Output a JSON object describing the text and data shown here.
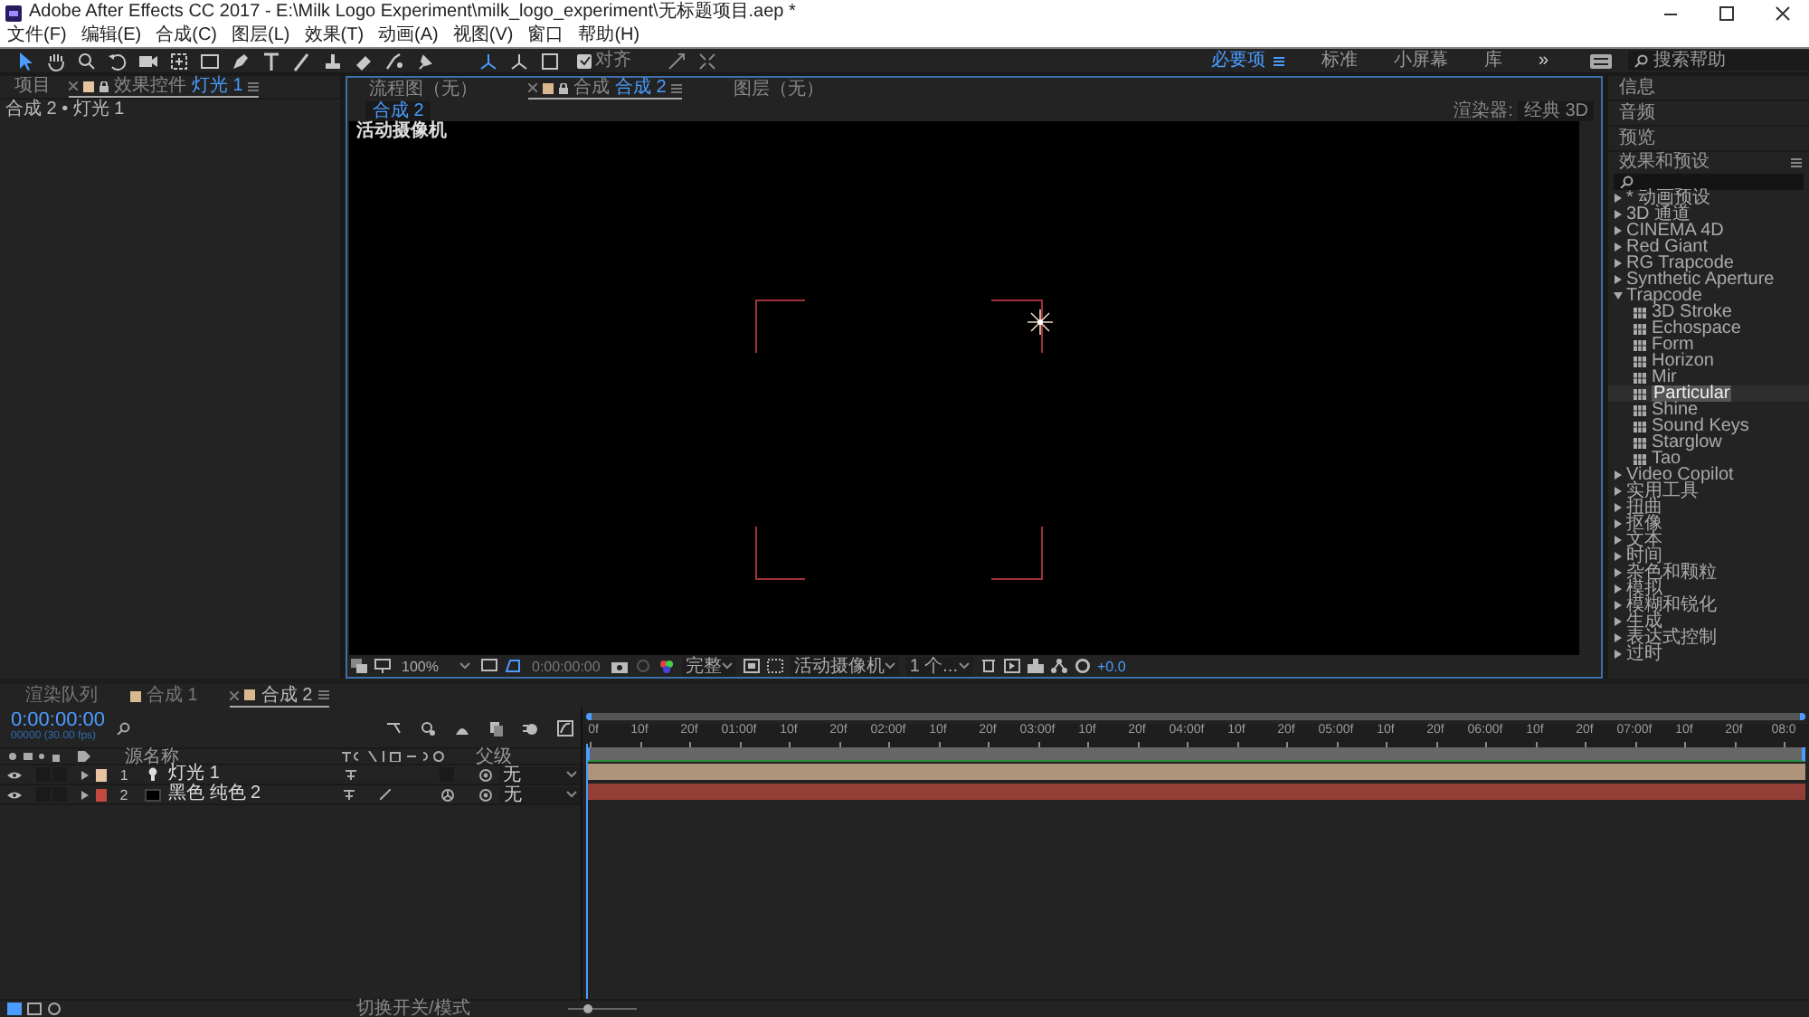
{
  "window": {
    "title": "Adobe After Effects CC 2017 - E:\\Milk Logo Experiment\\milk_logo_experiment\\无标题项目.aep *"
  },
  "menu": [
    "文件(F)",
    "编辑(E)",
    "合成(C)",
    "图层(L)",
    "效果(T)",
    "动画(A)",
    "视图(V)",
    "窗口",
    "帮助(H)"
  ],
  "tools": [
    {
      "kind": "arrow",
      "selected": true
    },
    {
      "kind": "hand",
      "selected": false
    },
    {
      "kind": "zoom",
      "selected": false
    },
    {
      "kind": "rotate",
      "selected": false
    },
    {
      "kind": "camera",
      "selected": false
    },
    {
      "kind": "pan",
      "selected": false
    },
    {
      "kind": "rect",
      "selected": false
    },
    {
      "kind": "pen",
      "selected": false
    },
    {
      "kind": "text",
      "selected": false
    },
    {
      "kind": "brush",
      "selected": false
    },
    {
      "kind": "stamp",
      "selected": false
    },
    {
      "kind": "eraser",
      "selected": false
    },
    {
      "kind": "roto",
      "selected": false
    },
    {
      "kind": "pin",
      "selected": false
    }
  ],
  "snapping": {
    "label": "对齐",
    "checked": true
  },
  "workspaces": [
    {
      "label": "必要项",
      "selected": true
    },
    {
      "label": "标准",
      "selected": false
    },
    {
      "label": "小屏幕",
      "selected": false
    },
    {
      "label": "库",
      "selected": false
    }
  ],
  "workspace_overflow": "»",
  "help_search": {
    "placeholder": "搜索帮助"
  },
  "left_panel": {
    "tabs": [
      {
        "label": "项目",
        "selected": false
      },
      {
        "label": "效果控件",
        "target": "灯光 1",
        "selected": true
      }
    ],
    "subtitle": "合成 2 • 灯光 1"
  },
  "comp_panel": {
    "tabs": [
      {
        "label": "流程图（无）",
        "selected": false
      },
      {
        "label": "合成",
        "target": "合成 2",
        "selected": true
      },
      {
        "label": "图层（无）",
        "selected": false
      }
    ],
    "subtab": "合成 2",
    "renderer_label": "渲染器:",
    "renderer": "经典 3D",
    "view_label": "活动摄像机",
    "footer": {
      "zoom": "100%",
      "time": "0:00:00:00",
      "resolution": "完整",
      "camera": "活动摄像机",
      "views": "1 个...",
      "exposure": "+0.0"
    }
  },
  "right_panel": {
    "sections": [
      "信息",
      "音频",
      "预览"
    ],
    "effects_title": "效果和预设",
    "effects": [
      {
        "label": "* 动画预设",
        "expanded": false
      },
      {
        "label": "3D 通道",
        "expanded": false
      },
      {
        "label": "CINEMA 4D",
        "expanded": false
      },
      {
        "label": "Red Giant",
        "expanded": false
      },
      {
        "label": "RG Trapcode",
        "expanded": false
      },
      {
        "label": "Synthetic Aperture",
        "expanded": false
      },
      {
        "label": "Trapcode",
        "expanded": true,
        "children": [
          {
            "label": "3D Stroke",
            "selected": false
          },
          {
            "label": "Echospace",
            "selected": false
          },
          {
            "label": "Form",
            "selected": false
          },
          {
            "label": "Horizon",
            "selected": false
          },
          {
            "label": "Mir",
            "selected": false
          },
          {
            "label": "Particular",
            "selected": true
          },
          {
            "label": "Shine",
            "selected": false
          },
          {
            "label": "Sound Keys",
            "selected": false
          },
          {
            "label": "Starglow",
            "selected": false
          },
          {
            "label": "Tao",
            "selected": false
          }
        ]
      },
      {
        "label": "Video Copilot",
        "expanded": false
      },
      {
        "label": "实用工具",
        "expanded": false
      },
      {
        "label": "扭曲",
        "expanded": false
      },
      {
        "label": "抠像",
        "expanded": false
      },
      {
        "label": "文本",
        "expanded": false
      },
      {
        "label": "时间",
        "expanded": false
      },
      {
        "label": "杂色和颗粒",
        "expanded": false
      },
      {
        "label": "模拟",
        "expanded": false
      },
      {
        "label": "模糊和锐化",
        "expanded": false
      },
      {
        "label": "生成",
        "expanded": false
      },
      {
        "label": "表达式控制",
        "expanded": false
      },
      {
        "label": "过时",
        "expanded": false
      }
    ]
  },
  "timeline": {
    "tabs": [
      {
        "label": "渲染队列",
        "selected": false
      },
      {
        "label": "合成 1",
        "selected": false
      },
      {
        "label": "合成 2",
        "selected": true
      }
    ],
    "time": "0:00:00:00",
    "frame_info": "00000 (30.00 fps)",
    "columns": [
      "源名称",
      "父级"
    ],
    "layers": [
      {
        "index": "1",
        "name": "灯光 1",
        "kind": "light",
        "color": "#e8c4a0",
        "solo": false,
        "locked": false,
        "parent": "无"
      },
      {
        "index": "2",
        "name": "黑色 纯色 2",
        "kind": "solid",
        "color": "#c44a3f",
        "solo": false,
        "locked": false,
        "parent": "无"
      }
    ],
    "ruler": [
      "0f",
      "10f",
      "20f",
      "01:00f",
      "10f",
      "20f",
      "02:00f",
      "10f",
      "20f",
      "03:00f",
      "10f",
      "20f",
      "04:00f",
      "10f",
      "20f",
      "05:00f",
      "10f",
      "20f",
      "06:00f",
      "10f",
      "20f",
      "07:00f",
      "10f",
      "20f",
      "08:0"
    ],
    "status": "切换开关/模式"
  }
}
